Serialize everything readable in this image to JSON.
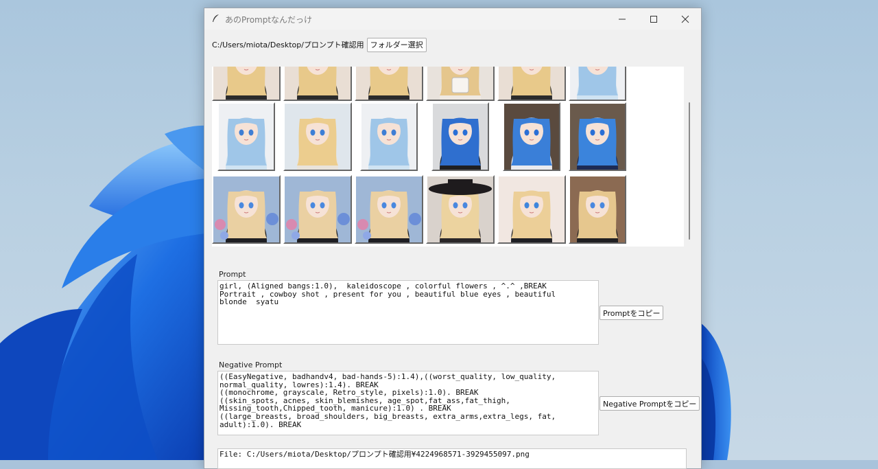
{
  "window": {
    "title": "あのPromptなんだっけ"
  },
  "folder": {
    "path": "C:/Users/miota/Desktop/プロンプト確認用",
    "select_button": "フォルダー選択"
  },
  "gallery": {
    "rows": [
      [
        "blonde-girl",
        "blonde-girl",
        "blonde-girl",
        "blonde-girl-cup",
        "blonde-girl",
        "blue-hair-hoodie-girl"
      ],
      [
        "blue-hair-hoodie-girl",
        "blonde-girl-portrait",
        "blue-hair-hoodie-girl",
        "blue-hair-black-hoodie-girl",
        "blue-hair-white-hoodie-girl",
        "blue-hair-navy-hoodie-girl"
      ],
      [
        "blonde-girl-flowers",
        "blonde-girl-flowers",
        "blonde-girl-flowers",
        "blonde-girl-hat",
        "blonde-girl-blue-streak",
        "blonde-girl-black-top"
      ]
    ]
  },
  "prompt": {
    "label": "Prompt",
    "value": "girl, (Aligned bangs:1.0),  kaleidoscope , colorful flowers , ^.^ ,BREAK\nPortrait , cowboy shot , present for you , beautiful blue eyes , beautiful\nblonde  syatu",
    "copy_button": "Promptをコピー"
  },
  "negative_prompt": {
    "label": "Negative Prompt",
    "value": "((EasyNegative, badhandv4, bad-hands-5):1.4),((worst_quality, low_quality,\nnormal_quality, lowres):1.4). BREAK\n((monochrome, grayscale, Retro_style, pixels):1.0). BREAK\n((skin_spots, acnes, skin_blemishes, age_spot,fat_ass,fat_thigh,\nMissing_tooth,Chipped_tooth, manicure):1.0) . BREAK\n((large_breasts, broad_shoulders, big_breasts, extra_arms,extra_legs, fat,\nadult):1.0). BREAK",
    "copy_button": "Negative Promptをコピー"
  },
  "file": {
    "value": "File: C:/Users/miota/Desktop/プロンプト確認用¥4224968571-3929455097.png"
  },
  "colors": {
    "window_bg": "#f0f0f0",
    "wallpaper_blue": "#1f6fe0"
  }
}
